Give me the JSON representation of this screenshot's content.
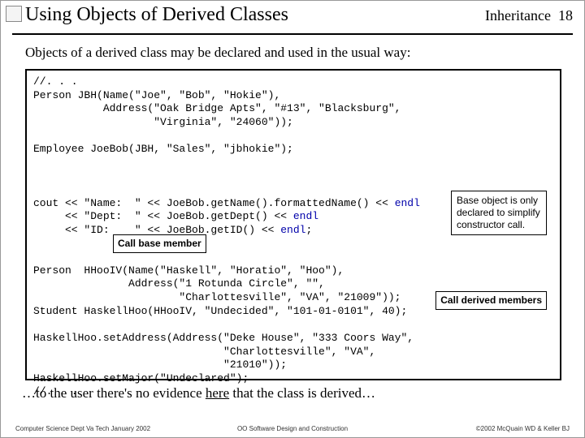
{
  "header": {
    "title": "Using Objects of Derived Classes",
    "section": "Inheritance",
    "page": "18"
  },
  "intro": "Objects of a derived class may be declared and used in the usual way:",
  "code": {
    "l1": "//. . .",
    "l2": "Person JBH(Name(\"Joe\", \"Bob\", \"Hokie\"),",
    "l3": "           Address(\"Oak Bridge Apts\", \"#13\", \"Blacksburg\",",
    "l4": "                   \"Virginia\", \"24060\"));",
    "l5": "",
    "l6": "Employee JoeBob(JBH, \"Sales\", \"jbhokie\");",
    "l7a": "cout << \"Name:  \" << JoeBob.getName().formattedName() << ",
    "l7b": "endl",
    "l8a": "     << \"Dept:  \" << JoeBob.getDept() << ",
    "l8b": "endl",
    "l9a": "     << \"ID:    \" << JoeBob.getID() << ",
    "l9b": "endl",
    "l9c": ";",
    "l10": "",
    "l11": "Person  HHooIV(Name(\"Haskell\", \"Horatio\", \"Hoo\"),",
    "l12": "               Address(\"1 Rotunda Circle\", \"\",",
    "l13": "                       \"Charlottesville\", \"VA\", \"21009\"));",
    "l14": "Student HaskellHoo(HHooIV, \"Undecided\", \"101-01-0101\", 40);",
    "l15": "",
    "l16": "HaskellHoo.setAddress(Address(\"Deke House\", \"333 Coors Way\",",
    "l17": "                              \"Charlottesville\", \"VA\",",
    "l18": "                              \"21010\"));",
    "l19": "HaskellHoo.setMajor(\"Undeclared\");",
    "l20": "//. . ."
  },
  "callouts": {
    "base_object": "Base object is only declared to simplify constructor call.",
    "call_base": "Call base member",
    "call_derived": "Call derived members"
  },
  "outro": {
    "pre": "…to the user there's no evidence ",
    "here": "here",
    "post": " that the class is derived…"
  },
  "footer": {
    "left": "Computer Science Dept Va Tech January 2002",
    "center": "OO Software Design and Construction",
    "right": "©2002  McQuain WD & Keller BJ"
  }
}
